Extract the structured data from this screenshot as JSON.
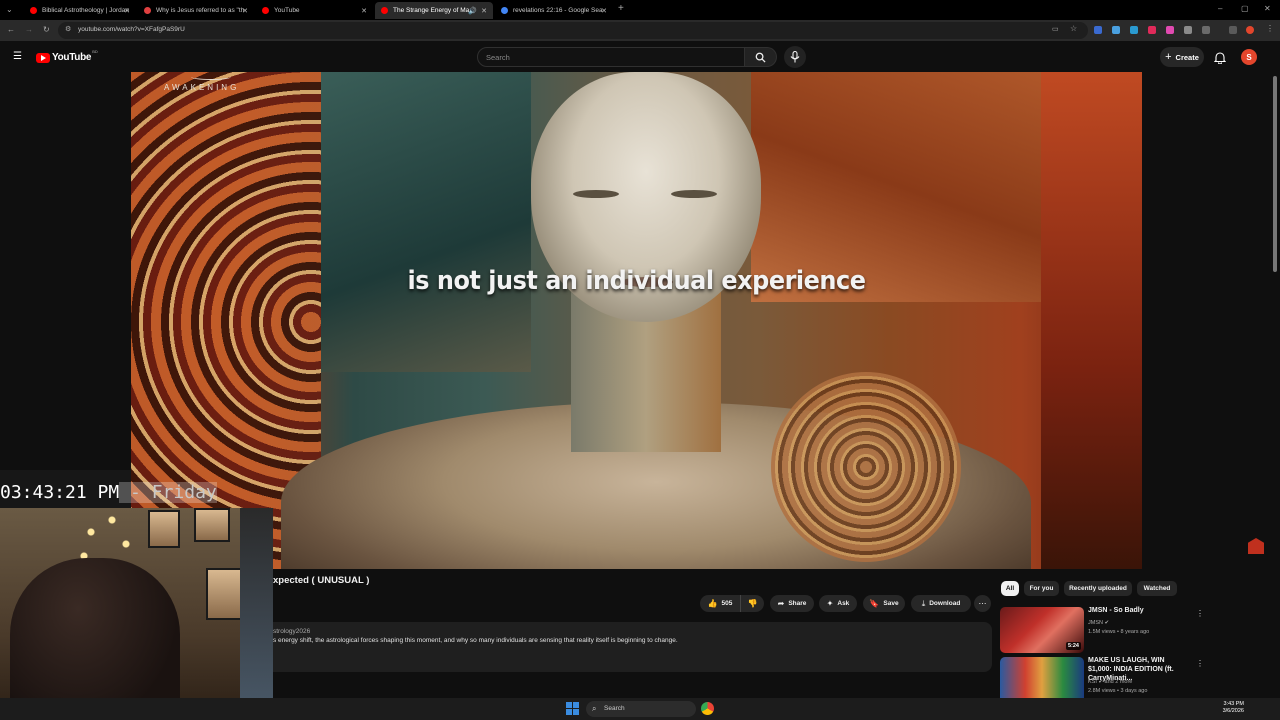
{
  "browser": {
    "tabs": [
      {
        "title": "Biblical Astrotheology | Jordan"
      },
      {
        "title": "Why is Jesus referred to as \"th"
      },
      {
        "title": "YouTube"
      },
      {
        "title": "The Strange Energy of Ma"
      },
      {
        "title": "revelations 22:16 - Google Sea"
      }
    ],
    "active_tab": 3,
    "url": "youtube.com/watch?v=XFafgPaS9rU",
    "new_tab_label": "+"
  },
  "youtube": {
    "logo_text": "YouTube",
    "logo_region": "BD",
    "search_placeholder": "Search",
    "create_label": "Create",
    "avatar_letter": "S"
  },
  "video": {
    "caption": "is not just an individual experience",
    "brand_text": "AWAKENING",
    "title_fragment": "xpected ( UNUSUAL )",
    "channel_fragment": "strology2026",
    "description": "s energy shift, the astrological forces shaping this moment, and why so many individuals are sensing that reality itself is beginning to change.",
    "like_count": "505",
    "share_label": "Share",
    "ask_label": "Ask",
    "save_label": "Save",
    "download_label": "Download"
  },
  "overlay": {
    "clock_time": "03:43:21 PM",
    "clock_day": " - Friday"
  },
  "sidebar": {
    "chips": [
      "All",
      "For you",
      "Recently uploaded",
      "Watched"
    ],
    "active_chip": 0,
    "recommendations": [
      {
        "title": "JMSN - So Badly",
        "channel": "JMSN",
        "meta": "1.5M views • 8 years ago",
        "duration": "5:24"
      },
      {
        "title": "MAKE US LAUGH, WIN $1,000: INDIA EDITION (ft. CarryMinati...",
        "channel": "KSI",
        "channel_extra": "and 2 more",
        "meta": "2.8M views • 3 days ago",
        "duration": ""
      }
    ]
  },
  "taskbar": {
    "search_placeholder": "Search",
    "time": "3:43 PM",
    "date": "3/6/2026"
  },
  "colors": {
    "yt_red": "#ff0000",
    "avatar": "#e3462c",
    "background": "#0f0f0f"
  }
}
